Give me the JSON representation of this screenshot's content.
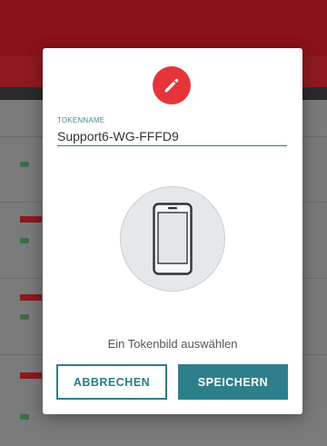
{
  "dialog": {
    "icon": "pencil-icon",
    "token_name_label": "TOKENNAME",
    "token_name_value": "Support6-WG-FFFD9",
    "device_icon": "smartphone-icon",
    "pick_image_text": "Ein Tokenbild auswählen",
    "cancel_label": "ABBRECHEN",
    "save_label": "SPEICHERN"
  },
  "colors": {
    "accent": "#2b7d8a",
    "badge": "#e5343a",
    "app_bar": "#8a1219"
  }
}
